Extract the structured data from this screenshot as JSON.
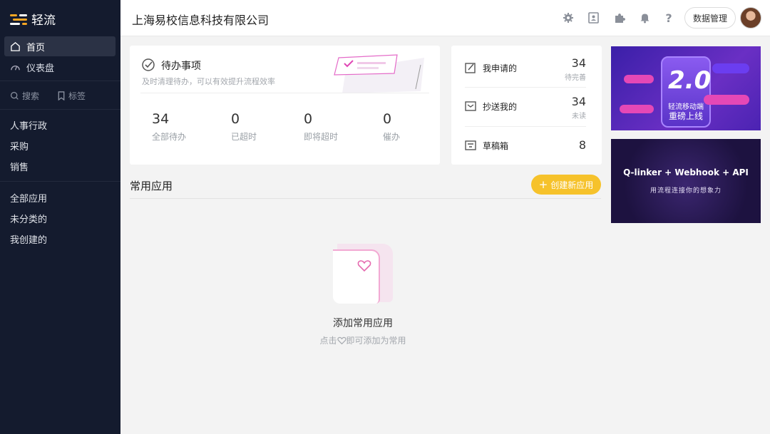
{
  "app": {
    "name": "轻流",
    "logo_colors": [
      "#f5a623",
      "#ffffff"
    ]
  },
  "sidebar": {
    "nav": [
      {
        "label": "首页",
        "icon": "home-icon",
        "active": true
      },
      {
        "label": "仪表盘",
        "icon": "dashboard-icon",
        "active": false
      }
    ],
    "search_label": "搜索",
    "tag_label": "标签",
    "groups": [
      "人事行政",
      "采购",
      "销售"
    ],
    "filters": [
      "全部应用",
      "未分类的",
      "我创建的"
    ]
  },
  "header": {
    "company": "上海易校信息科技有限公司",
    "data_manage": "数据管理",
    "icons": [
      "gear-icon",
      "contacts-icon",
      "plugin-icon",
      "bell-icon",
      "help-icon"
    ]
  },
  "todo": {
    "title": "待办事项",
    "subtitle": "及时清理待办，可以有效提升流程效率",
    "stats": [
      {
        "value": "34",
        "label": "全部待办"
      },
      {
        "value": "0",
        "label": "已超时"
      },
      {
        "value": "0",
        "label": "即将超时"
      },
      {
        "value": "0",
        "label": "催办"
      }
    ]
  },
  "mine": [
    {
      "label": "我申请的",
      "value": "34",
      "sub": "待完善",
      "icon": "edit-icon"
    },
    {
      "label": "抄送我的",
      "value": "34",
      "sub": "未读",
      "icon": "inbox-icon"
    },
    {
      "label": "草稿箱",
      "value": "8",
      "sub": "",
      "icon": "draft-icon"
    }
  ],
  "banner1": {
    "version": "2.0",
    "title": "轻流移动端",
    "subtitle": "重磅上线",
    "colors": [
      "#4a2dbe",
      "#7a32c8"
    ]
  },
  "banner2": {
    "title": "Q-linker + Webhook + API",
    "subtitle": "用流程连接你的想象力",
    "color": "#2a1a52"
  },
  "apps": {
    "section_title": "常用应用",
    "create_label": "创建新应用",
    "empty_title": "添加常用应用",
    "empty_hint_pre": "点击",
    "empty_hint_post": "即可添加为常用"
  },
  "accent": "#f6c22b"
}
